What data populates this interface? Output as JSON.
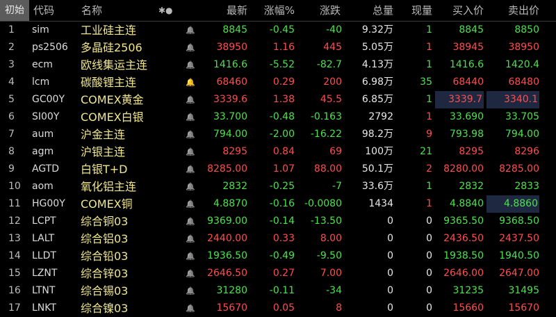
{
  "header": {
    "tab": "初始",
    "code": "代码",
    "name": "名称",
    "icons": "✱●",
    "latest": "最新",
    "change_pct": "涨幅%",
    "change": "涨跌",
    "volume": "总量",
    "current_vol": "现量",
    "bid": "买入价",
    "ask": "卖出价"
  },
  "colors": {
    "up": "#ff4d4d",
    "down": "#4ce24c",
    "name": "#f0e68c",
    "highlight": "#1e2840"
  },
  "rows": [
    {
      "no": "1",
      "code": "sim",
      "name": "工业硅主连",
      "bell": "bell-icon",
      "last": "8845",
      "pct": "-0.45",
      "chg": "-40",
      "vol": "9.32万",
      "cur": "1",
      "bid": "8845",
      "ask": "8850",
      "dir": "down",
      "bid_dir": "down",
      "ask_dir": "down",
      "cur_dir": "down"
    },
    {
      "no": "2",
      "code": "ps2506",
      "name": "多晶硅2506",
      "bell": "bell-icon",
      "last": "38950",
      "pct": "1.16",
      "chg": "445",
      "vol": "5.05万",
      "cur": "1",
      "bid": "38945",
      "ask": "38950",
      "dir": "up",
      "bid_dir": "up",
      "ask_dir": "up",
      "cur_dir": "up"
    },
    {
      "no": "3",
      "code": "ecm",
      "name": "欧线集运主连",
      "bell": "bell-icon",
      "last": "1416.6",
      "pct": "-5.52",
      "chg": "-82.7",
      "vol": "4.13万",
      "cur": "1",
      "bid": "1416.6",
      "ask": "1420.4",
      "dir": "down",
      "bid_dir": "down",
      "ask_dir": "down",
      "cur_dir": "down"
    },
    {
      "no": "4",
      "code": "lcm",
      "name": "碳酸锂主连",
      "bell": "bell-icon",
      "bell_on": true,
      "last": "68460",
      "pct": "0.29",
      "chg": "200",
      "vol": "6.98万",
      "cur": "35",
      "bid": "68440",
      "ask": "68480",
      "dir": "up",
      "bid_dir": "up",
      "ask_dir": "up",
      "cur_dir": "down"
    },
    {
      "no": "5",
      "code": "GC00Y",
      "name": "COMEX黄金",
      "bell": "bell-icon",
      "last": "3339.6",
      "pct": "1.38",
      "chg": "45.5",
      "vol": "6.85万",
      "cur": "1",
      "bid": "3339.7",
      "ask": "3340.1",
      "dir": "up",
      "bid_dir": "up",
      "ask_dir": "up",
      "cur_dir": "down",
      "hl_bid": true,
      "hl_ask": true
    },
    {
      "no": "6",
      "code": "SI00Y",
      "name": "COMEX白银",
      "bell": "bell-icon",
      "last": "33.700",
      "pct": "-0.48",
      "chg": "-0.163",
      "vol": "2792",
      "cur": "1",
      "bid": "33.690",
      "ask": "33.705",
      "dir": "down",
      "bid_dir": "down",
      "ask_dir": "down",
      "cur_dir": "up"
    },
    {
      "no": "7",
      "code": "aum",
      "name": "沪金主连",
      "bell": "bell-icon",
      "last": "794.00",
      "pct": "-2.00",
      "chg": "-16.22",
      "vol": "98.2万",
      "cur": "9",
      "bid": "793.98",
      "ask": "794.00",
      "dir": "down",
      "bid_dir": "down",
      "ask_dir": "down",
      "cur_dir": "up"
    },
    {
      "no": "8",
      "code": "agm",
      "name": "沪银主连",
      "bell": "bell-icon",
      "last": "8295",
      "pct": "0.84",
      "chg": "69",
      "vol": "100万",
      "cur": "21",
      "bid": "8295",
      "ask": "8296",
      "dir": "up",
      "bid_dir": "up",
      "ask_dir": "up",
      "cur_dir": "down"
    },
    {
      "no": "9",
      "code": "AGTD",
      "name": "白银T+D",
      "bell": "bell-icon",
      "last": "8285.00",
      "pct": "1.07",
      "chg": "88.00",
      "vol": "50.1万",
      "cur": "2",
      "bid": "8280.00",
      "ask": "8285.00",
      "dir": "up",
      "bid_dir": "up",
      "ask_dir": "up",
      "cur_dir": "up"
    },
    {
      "no": "10",
      "code": "aom",
      "name": "氧化铝主连",
      "bell": "bell-icon",
      "last": "2832",
      "pct": "-0.25",
      "chg": "-7",
      "vol": "33.6万",
      "cur": "1",
      "bid": "2832",
      "ask": "2833",
      "dir": "down",
      "bid_dir": "down",
      "ask_dir": "down",
      "cur_dir": "down"
    },
    {
      "no": "11",
      "code": "HG00Y",
      "name": "COMEX铜",
      "bell": "bell-icon",
      "last": "4.8870",
      "pct": "-0.16",
      "chg": "-0.0080",
      "vol": "1434",
      "cur": "1",
      "bid": "4.8840",
      "ask": "4.8860",
      "dir": "down",
      "bid_dir": "down",
      "ask_dir": "down",
      "cur_dir": "up",
      "hl_ask": true
    },
    {
      "no": "12",
      "code": "LCPT",
      "name": "综合铜03",
      "bell": "bell-icon",
      "last": "9369.00",
      "pct": "-0.14",
      "chg": "-13.50",
      "vol": "0",
      "cur": "0",
      "bid": "9365.50",
      "ask": "9368.50",
      "dir": "down",
      "bid_dir": "down",
      "ask_dir": "down",
      "cur_dir": "neutral"
    },
    {
      "no": "13",
      "code": "LALT",
      "name": "综合铝03",
      "bell": "bell-icon",
      "last": "2440.00",
      "pct": "0.33",
      "chg": "8.00",
      "vol": "0",
      "cur": "0",
      "bid": "2436.50",
      "ask": "2437.50",
      "dir": "up",
      "bid_dir": "up",
      "ask_dir": "up",
      "cur_dir": "neutral"
    },
    {
      "no": "14",
      "code": "LLDT",
      "name": "综合铅03",
      "bell": "bell-icon",
      "last": "1936.50",
      "pct": "-0.49",
      "chg": "-9.50",
      "vol": "0",
      "cur": "0",
      "bid": "1938.50",
      "ask": "1940.50",
      "dir": "down",
      "bid_dir": "down",
      "ask_dir": "down",
      "cur_dir": "neutral"
    },
    {
      "no": "15",
      "code": "LZNT",
      "name": "综合锌03",
      "bell": "bell-icon",
      "last": "2646.50",
      "pct": "0.27",
      "chg": "7.00",
      "vol": "0",
      "cur": "0",
      "bid": "2646.00",
      "ask": "2647.00",
      "dir": "up",
      "bid_dir": "up",
      "ask_dir": "up",
      "cur_dir": "neutral"
    },
    {
      "no": "16",
      "code": "LTNT",
      "name": "综合锡03",
      "bell": "bell-icon",
      "last": "31280",
      "pct": "-0.11",
      "chg": "-34",
      "vol": "0",
      "cur": "0",
      "bid": "31235",
      "ask": "31495",
      "dir": "down",
      "bid_dir": "down",
      "ask_dir": "down",
      "cur_dir": "neutral"
    },
    {
      "no": "17",
      "code": "LNKT",
      "name": "综合镍03",
      "bell": "bell-icon",
      "last": "15670",
      "pct": "0.05",
      "chg": "8",
      "vol": "0",
      "cur": "0",
      "bid": "15660",
      "ask": "15670",
      "dir": "up",
      "bid_dir": "up",
      "ask_dir": "up",
      "cur_dir": "neutral"
    }
  ]
}
